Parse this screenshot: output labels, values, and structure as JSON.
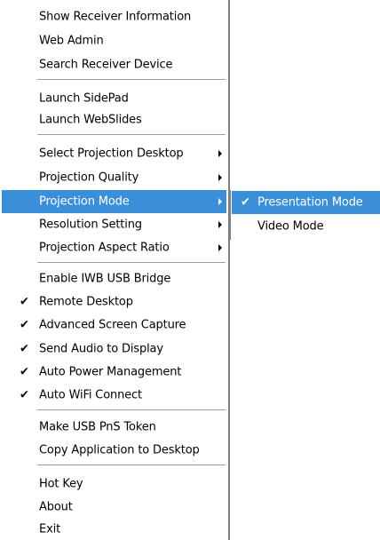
{
  "menu": {
    "items": [
      {
        "label": "Show Receiver Information"
      },
      {
        "label": "Web Admin"
      },
      {
        "label": "Search Receiver Device"
      },
      {
        "label": "Launch SidePad"
      },
      {
        "label": "Launch WebSlides"
      },
      {
        "label": "Select Projection Desktop",
        "submenu": true
      },
      {
        "label": "Projection Quality",
        "submenu": true
      },
      {
        "label": "Projection Mode",
        "submenu": true,
        "highlighted": true
      },
      {
        "label": "Resolution Setting",
        "submenu": true
      },
      {
        "label": "Projection Aspect Ratio",
        "submenu": true
      },
      {
        "label": "Enable IWB USB Bridge"
      },
      {
        "label": "Remote Desktop",
        "checked": true
      },
      {
        "label": "Advanced Screen Capture",
        "checked": true
      },
      {
        "label": "Send Audio to Display",
        "checked": true
      },
      {
        "label": "Auto Power Management",
        "checked": true
      },
      {
        "label": "Auto WiFi Connect",
        "checked": true
      },
      {
        "label": "Make USB PnS Token"
      },
      {
        "label": "Copy Application to Desktop"
      },
      {
        "label": "Hot Key"
      },
      {
        "label": "About"
      },
      {
        "label": "Exit"
      }
    ],
    "check_glyph": "✔"
  },
  "submenu": {
    "items": [
      {
        "label": "Presentation Mode",
        "checked": true,
        "highlighted": true
      },
      {
        "label": "Video Mode"
      }
    ]
  },
  "colors": {
    "highlight": "#3b8ed8",
    "separator": "#a0a0a0",
    "border": "#7f7f7f"
  }
}
